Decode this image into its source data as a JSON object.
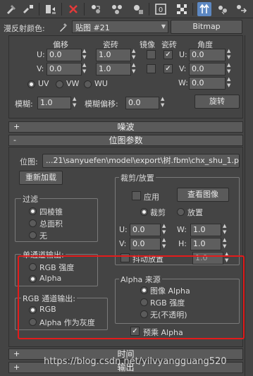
{
  "toolbar": {
    "icons": [
      "pick-material-icon",
      "put-to-scene-icon",
      "assign-material-icon",
      "reset-map-icon",
      "copy-material-icon",
      "make-unique-icon",
      "put-to-library-icon",
      "material-id-channel-icon",
      "show-shaded-icon",
      "show-end-result-icon",
      "go-to-parent-icon",
      "go-forward-sibling-icon"
    ]
  },
  "diffuse": {
    "label": "漫反射颜色:",
    "map_name": "贴图 #21",
    "map_type": "Bitmap"
  },
  "coords": {
    "headers": {
      "offset": "偏移",
      "tiling": "瓷砖",
      "mirror": "镜像",
      "tile": "瓷砖",
      "angle": "角度"
    },
    "u": {
      "label": "U:",
      "offset": "0.0",
      "tiling": "1.0",
      "mirror": false,
      "tile": true,
      "angle_label": "U:",
      "angle": "0.0"
    },
    "v": {
      "label": "V:",
      "offset": "0.0",
      "tiling": "1.0",
      "mirror": false,
      "tile": true,
      "angle_label": "V:",
      "angle": "0.0"
    },
    "w": {
      "angle_label": "W:",
      "angle": "0.0"
    },
    "uvw": [
      "UV",
      "VW",
      "WU"
    ],
    "blur_label": "模糊:",
    "blur_value": "1.0",
    "blur_offset_label": "模糊偏移:",
    "blur_offset_value": "0.0",
    "rotate_button": "旋转"
  },
  "rollouts": {
    "noise": {
      "sign": "+",
      "title": "噪波"
    },
    "bitmap_params": {
      "sign": "-",
      "title": "位图参数"
    },
    "time": {
      "sign": "+",
      "title": "时间"
    },
    "output": {
      "sign": "+",
      "title": "输出"
    }
  },
  "bitmap": {
    "path_label": "位图:",
    "path_value": "...21\\sanyuefen\\model\\export\\树.fbm\\chx_shu_1.png",
    "reload_button": "重新加载"
  },
  "filtering": {
    "title": "过滤",
    "options": [
      "四棱锥",
      "总面积",
      "无"
    ],
    "selected": 0
  },
  "mono_output": {
    "title": "单通道输出:",
    "options": [
      "RGB 强度",
      "Alpha"
    ],
    "selected": 1
  },
  "rgb_output": {
    "title": "RGB 通道输出:",
    "options": [
      "RGB",
      "Alpha 作为灰度"
    ],
    "selected": 0
  },
  "crop": {
    "title": "裁剪/放置",
    "apply_label": "应用",
    "view_button": "查看图像",
    "mode_crop": "裁剪",
    "mode_place": "放置",
    "u_label": "U:",
    "u_value": "0.0",
    "v_label": "V:",
    "v_value": "0.0",
    "w_label": "W:",
    "w_value": "1.0",
    "h_label": "H:",
    "h_value": "1.0",
    "jitter_label": "抖动放置",
    "jitter_value": "1.0"
  },
  "alpha_source": {
    "title": "Alpha 来源",
    "options": [
      "图像 Alpha",
      "RGB 强度",
      "无(不透明)"
    ],
    "selected": 0,
    "premult_label": "预乘 Alpha",
    "premult_checked": true
  },
  "watermark": "https://blog.csdn.net/yilvyangguang520",
  "colors": {
    "highlight_border": "#e31b1b",
    "active_tool": "#5d88c2",
    "background": "#444444"
  }
}
